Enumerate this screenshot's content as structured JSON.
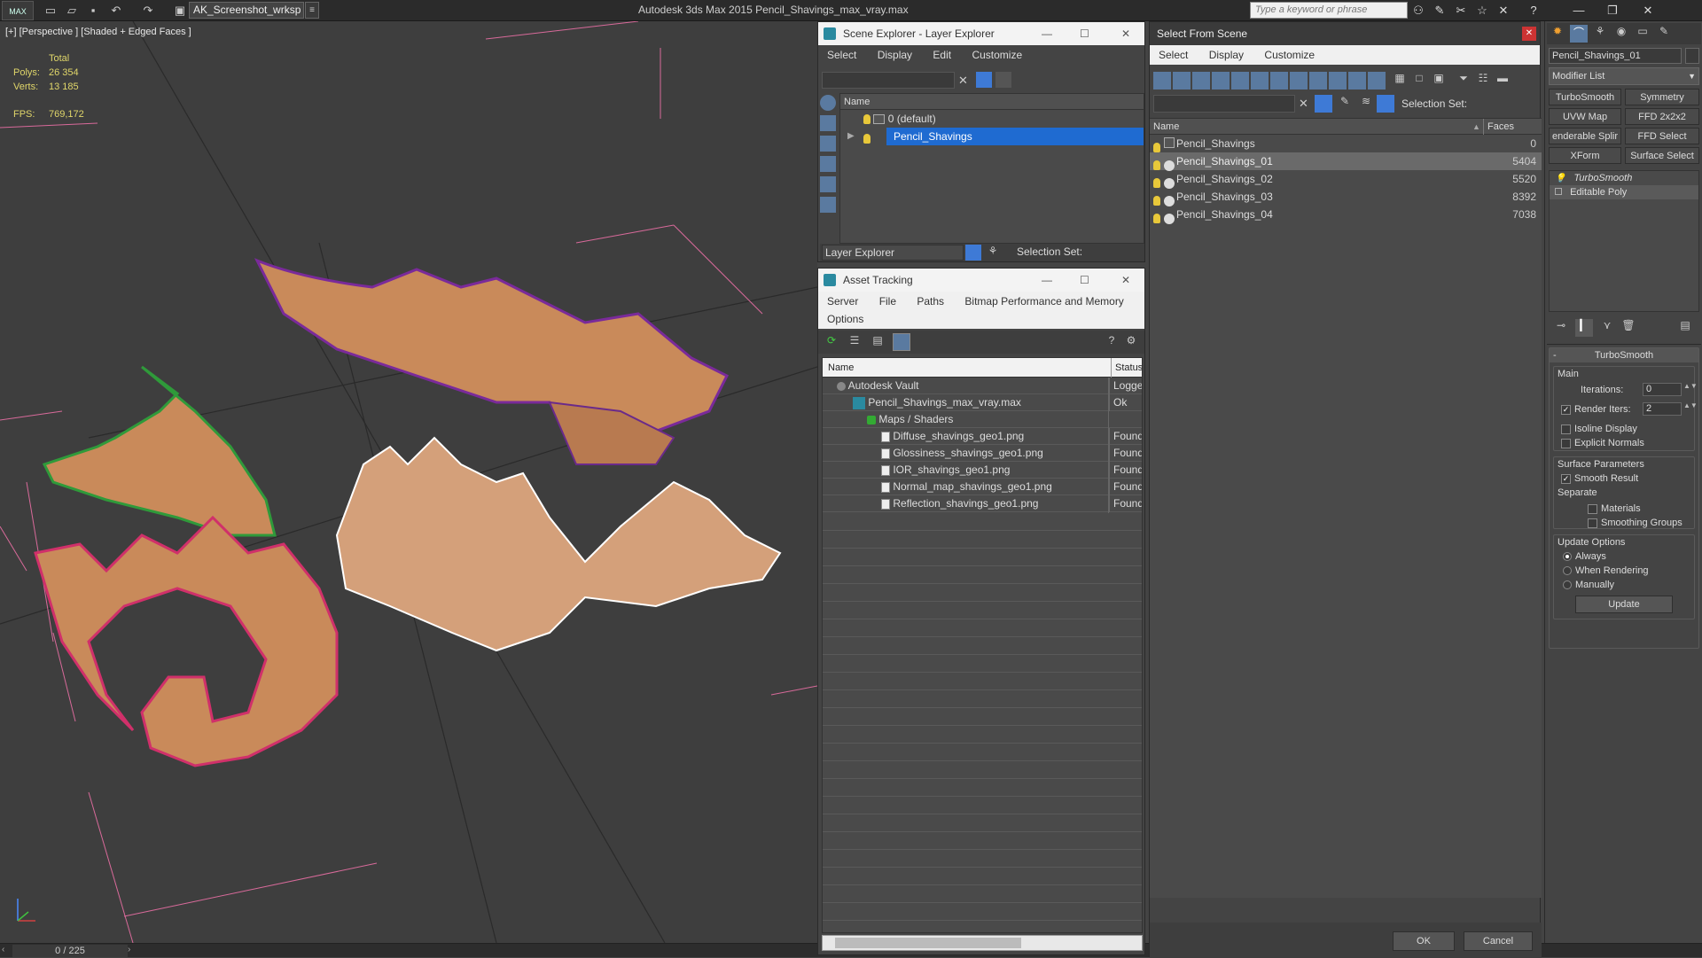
{
  "app": {
    "title": "Autodesk 3ds Max  2015     Pencil_Shavings_max_vray.max",
    "logo": "MAX",
    "workspace": "AK_Screenshot_wrksp",
    "search_placeholder": "Type a keyword or phrase"
  },
  "viewport": {
    "label": "[+] [Perspective ] [Shaded + Edged Faces ]",
    "stats": {
      "total_label": "Total",
      "polys_label": "Polys:",
      "polys_value": "26 354",
      "verts_label": "Verts:",
      "verts_value": "13 185",
      "fps_label": "FPS:",
      "fps_value": "769,172"
    }
  },
  "statusbar": {
    "time": "0 / 225"
  },
  "scene_explorer": {
    "title": "Scene Explorer - Layer Explorer",
    "menu": [
      "Select",
      "Display",
      "Edit",
      "Customize"
    ],
    "column_name": "Name",
    "layers": [
      {
        "label": "0 (default)",
        "selected": false
      },
      {
        "label": "Pencil_Shavings",
        "selected": true
      }
    ],
    "footer_dropdown": "Layer Explorer",
    "selection_set_label": "Selection Set:"
  },
  "asset_tracking": {
    "title": "Asset Tracking",
    "menu": [
      "Server",
      "File",
      "Paths",
      "Bitmap Performance and Memory"
    ],
    "menu2": "Options",
    "col_name": "Name",
    "col_status": "Status",
    "rows": [
      {
        "name": "Autodesk Vault",
        "status": "Logged",
        "indent": 1
      },
      {
        "name": "Pencil_Shavings_max_vray.max",
        "status": "Ok",
        "indent": 2
      },
      {
        "name": "Maps / Shaders",
        "status": "",
        "indent": 3
      },
      {
        "name": "Diffuse_shavings_geo1.png",
        "status": "Found",
        "indent": 4
      },
      {
        "name": "Glossiness_shavings_geo1.png",
        "status": "Found",
        "indent": 4
      },
      {
        "name": "IOR_shavings_geo1.png",
        "status": "Found",
        "indent": 4
      },
      {
        "name": "Normal_map_shavings_geo1.png",
        "status": "Found",
        "indent": 4
      },
      {
        "name": "Reflection_shavings_geo1.png",
        "status": "Found",
        "indent": 4
      }
    ]
  },
  "select_from_scene": {
    "title": "Select From Scene",
    "menu": [
      "Select",
      "Display",
      "Customize"
    ],
    "selection_set_label": "Selection Set:",
    "col_name": "Name",
    "col_faces": "Faces",
    "rows": [
      {
        "name": "Pencil_Shavings",
        "faces": "0",
        "selected": false
      },
      {
        "name": "Pencil_Shavings_01",
        "faces": "5404",
        "selected": true
      },
      {
        "name": "Pencil_Shavings_02",
        "faces": "5520",
        "selected": false
      },
      {
        "name": "Pencil_Shavings_03",
        "faces": "8392",
        "selected": false
      },
      {
        "name": "Pencil_Shavings_04",
        "faces": "7038",
        "selected": false
      }
    ],
    "ok": "OK",
    "cancel": "Cancel"
  },
  "command_panel": {
    "object_name": "Pencil_Shavings_01",
    "modifier_list": "Modifier List",
    "buttons": [
      "TurboSmooth",
      "Symmetry",
      "UVW Map",
      "FFD 2x2x2",
      "enderable Splir",
      "FFD Select",
      "XForm",
      "Surface Select"
    ],
    "stack": [
      "TurboSmooth",
      "Editable Poly"
    ],
    "rollout_title": "TurboSmooth",
    "main_label": "Main",
    "iterations_label": "Iterations:",
    "iterations_value": "0",
    "render_iters_label": "Render Iters:",
    "render_iters_value": "2",
    "isoline_label": "Isoline Display",
    "explicit_label": "Explicit Normals",
    "surface_label": "Surface Parameters",
    "smooth_result_label": "Smooth Result",
    "separate_label": "Separate",
    "materials_label": "Materials",
    "smoothing_groups_label": "Smoothing Groups",
    "update_options_label": "Update Options",
    "always_label": "Always",
    "when_rendering_label": "When Rendering",
    "manually_label": "Manually",
    "update_button": "Update"
  }
}
